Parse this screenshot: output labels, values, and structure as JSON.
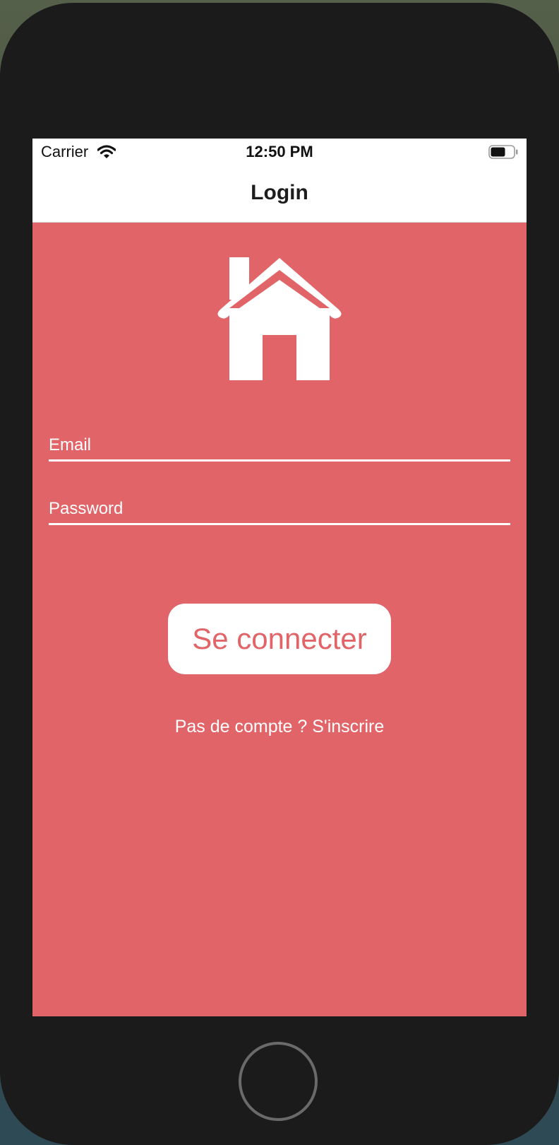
{
  "status_bar": {
    "carrier": "Carrier",
    "time": "12:50 PM"
  },
  "nav": {
    "title": "Login"
  },
  "form": {
    "email_placeholder": "Email",
    "password_placeholder": "Password",
    "submit_label": "Se connecter",
    "signup_link": "Pas de compte ? S'inscrire"
  },
  "colors": {
    "accent": "#e16568",
    "field_line": "#ffffff",
    "button_bg": "#ffffff"
  },
  "icons": [
    "wifi-icon",
    "battery-icon",
    "house-icon"
  ]
}
